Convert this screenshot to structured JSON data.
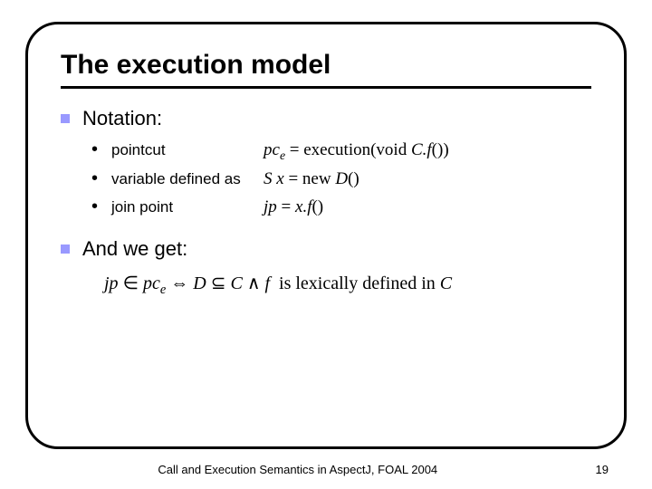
{
  "title": "The execution model",
  "notation": {
    "label": "Notation:",
    "items": [
      {
        "label": "pointcut",
        "formula_html": "pc_e = execution(void C.f())"
      },
      {
        "label": "variable defined as",
        "formula_html": "S x = new D()"
      },
      {
        "label": "join point",
        "formula_html": "jp = x.f()"
      }
    ]
  },
  "result": {
    "label": "And we get:",
    "formula_html": "jp ∈ pc_e ⇔ D ⊆ C ∧ f is lexically defined in C"
  },
  "footer": {
    "center": "Call and Execution Semantics in AspectJ, FOAL 2004",
    "page": "19"
  }
}
